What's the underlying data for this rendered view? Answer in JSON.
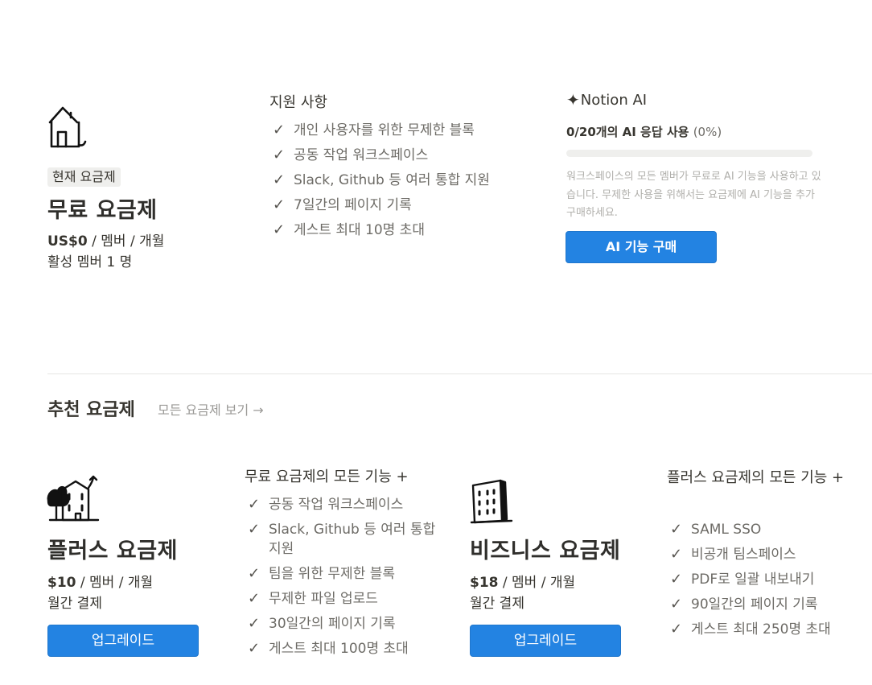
{
  "current_plan": {
    "badge": "현재 요금제",
    "name": "무료 요금제",
    "price": "US$0",
    "price_unit": " / 멤버 / 개월",
    "active_members": "활성 멤버 1 명"
  },
  "support": {
    "title": "지원 사항",
    "items": [
      "개인 사용자를 위한 무제한 블록",
      "공동 작업 워크스페이스",
      "Slack, Github 등 여러 통합 지원",
      "7일간의 페이지 기록",
      "게스트 최대 10명 초대"
    ]
  },
  "notion_ai": {
    "title": "Notion AI",
    "usage": "0/20개의 AI 응답 사용",
    "usage_pct": "(0%)",
    "usage_fraction": 0,
    "description": "워크스페이스의 모든 멤버가 무료로 AI 기능을 사용하고 있습니다. 무제한 사용을 위해서는 요금제에 AI 기능을 추가 구매하세요.",
    "button": "AI 기능 구매"
  },
  "recommended": {
    "title": "추천 요금제",
    "view_all": "모든 요금제 보기 →"
  },
  "plus": {
    "name": "플러스 요금제",
    "price": "$10",
    "price_unit": " / 멤버 / 개월",
    "billing": "월간 결제",
    "button": "업그레이드",
    "features_title": "무료 요금제의 모든 기능 +",
    "features": [
      "공동 작업 워크스페이스",
      "Slack, Github 등 여러 통합 지원",
      "팀을 위한 무제한 블록",
      "무제한 파일 업로드",
      "30일간의 페이지 기록",
      "게스트 최대 100명 초대"
    ]
  },
  "business": {
    "name": "비즈니스 요금제",
    "price": "$18",
    "price_unit": " / 멤버 / 개월",
    "billing": "월간 결제",
    "button": "업그레이드",
    "features_title": "플러스 요금제의 모든 기능 +",
    "features": [
      "SAML SSO",
      "비공개 팀스페이스",
      "PDF로 일괄 내보내기",
      "90일간의 페이지 기록",
      "게스트 최대 250명 초대"
    ]
  },
  "icons": {
    "check": "checkmark-icon",
    "house": "house-icon",
    "plus_plan": "townhouse-icon",
    "business_plan": "office-building-icon",
    "sparkle": "sparkle-icon"
  },
  "colors": {
    "accent": "#2383e2",
    "text": "#37352f",
    "muted": "#6d6b66",
    "badge_bg": "#efefed"
  }
}
